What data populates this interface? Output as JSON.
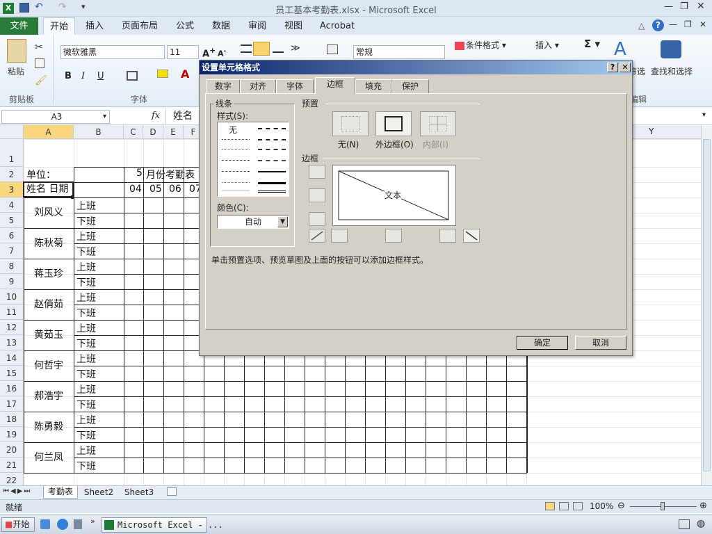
{
  "window": {
    "title": "员工基本考勤表.xlsx - Microsoft Excel"
  },
  "ribbon": {
    "file_tab": "文件",
    "tabs": [
      "开始",
      "插入",
      "页面布局",
      "公式",
      "数据",
      "审阅",
      "视图",
      "Acrobat"
    ],
    "active_tab": "开始",
    "paste_label": "粘贴",
    "clipboard_group": "剪贴板",
    "font_group": "字体",
    "font_name": "微软雅黑",
    "font_size": "11",
    "number_format": "常规",
    "conditional_format": "条件格式",
    "insert": "插入",
    "edit_group_partial": "编辑",
    "find_select": "查找和选择",
    "filter_partial": "筛选"
  },
  "formula": {
    "name_box": "A3",
    "fx": "fx",
    "content": "姓名"
  },
  "sheet": {
    "columns": [
      "A",
      "B",
      "C",
      "D",
      "E",
      "F",
      "Y"
    ],
    "rows": [
      "1",
      "2",
      "3",
      "4",
      "5",
      "6",
      "7",
      "8",
      "9",
      "10",
      "11",
      "12",
      "13",
      "14",
      "15",
      "16",
      "17",
      "18",
      "19",
      "20",
      "21",
      "22"
    ],
    "unit_label": "单位：",
    "month_label": "5",
    "title_partial": "月份考勤表",
    "a3": "姓名 日期",
    "dates": [
      "04",
      "05",
      "06",
      "07"
    ],
    "employees": [
      "刘风义",
      "陈秋菊",
      "蒋玉珍",
      "赵俏茹",
      "黄茹玉",
      "何哲宇",
      "郝浩宇",
      "陈勇毅",
      "何兰凤"
    ],
    "shift_on": "上班",
    "shift_off": "下班"
  },
  "sheet_tabs": [
    "考勤表",
    "Sheet2",
    "Sheet3"
  ],
  "status": {
    "ready": "就绪",
    "zoom": "100%"
  },
  "taskbar": {
    "start": "开始",
    "app": "Microsoft Excel - ..."
  },
  "dialog": {
    "title": "设置单元格格式",
    "tabs": [
      "数字",
      "对齐",
      "字体",
      "边框",
      "填充",
      "保护"
    ],
    "active_tab": "边框",
    "line_group": "线条",
    "style_label": "样式(S):",
    "style_none": "无",
    "color_label": "颜色(C):",
    "color_value": "自动",
    "preset_group": "预置",
    "presets": [
      "无(N)",
      "外边框(O)",
      "内部(I)"
    ],
    "border_group": "边框",
    "preview_text": "文本",
    "hint": "单击预置选项、预览草图及上面的按钮可以添加边框样式。",
    "ok": "确定",
    "cancel": "取消"
  }
}
